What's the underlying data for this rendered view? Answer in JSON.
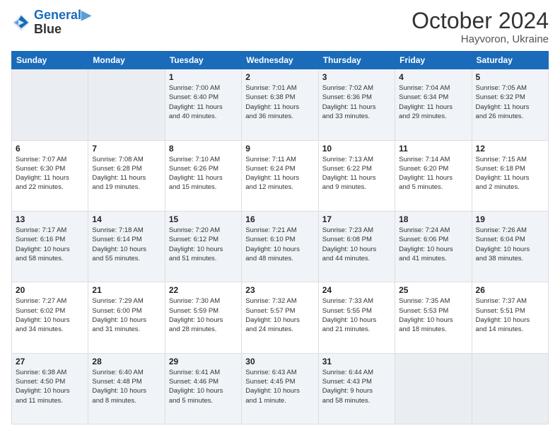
{
  "header": {
    "logo_line1": "General",
    "logo_line2": "Blue",
    "month": "October 2024",
    "location": "Hayvoron, Ukraine"
  },
  "weekdays": [
    "Sunday",
    "Monday",
    "Tuesday",
    "Wednesday",
    "Thursday",
    "Friday",
    "Saturday"
  ],
  "weeks": [
    [
      {
        "day": "",
        "text": ""
      },
      {
        "day": "",
        "text": ""
      },
      {
        "day": "1",
        "text": "Sunrise: 7:00 AM\nSunset: 6:40 PM\nDaylight: 11 hours\nand 40 minutes."
      },
      {
        "day": "2",
        "text": "Sunrise: 7:01 AM\nSunset: 6:38 PM\nDaylight: 11 hours\nand 36 minutes."
      },
      {
        "day": "3",
        "text": "Sunrise: 7:02 AM\nSunset: 6:36 PM\nDaylight: 11 hours\nand 33 minutes."
      },
      {
        "day": "4",
        "text": "Sunrise: 7:04 AM\nSunset: 6:34 PM\nDaylight: 11 hours\nand 29 minutes."
      },
      {
        "day": "5",
        "text": "Sunrise: 7:05 AM\nSunset: 6:32 PM\nDaylight: 11 hours\nand 26 minutes."
      }
    ],
    [
      {
        "day": "6",
        "text": "Sunrise: 7:07 AM\nSunset: 6:30 PM\nDaylight: 11 hours\nand 22 minutes."
      },
      {
        "day": "7",
        "text": "Sunrise: 7:08 AM\nSunset: 6:28 PM\nDaylight: 11 hours\nand 19 minutes."
      },
      {
        "day": "8",
        "text": "Sunrise: 7:10 AM\nSunset: 6:26 PM\nDaylight: 11 hours\nand 15 minutes."
      },
      {
        "day": "9",
        "text": "Sunrise: 7:11 AM\nSunset: 6:24 PM\nDaylight: 11 hours\nand 12 minutes."
      },
      {
        "day": "10",
        "text": "Sunrise: 7:13 AM\nSunset: 6:22 PM\nDaylight: 11 hours\nand 9 minutes."
      },
      {
        "day": "11",
        "text": "Sunrise: 7:14 AM\nSunset: 6:20 PM\nDaylight: 11 hours\nand 5 minutes."
      },
      {
        "day": "12",
        "text": "Sunrise: 7:15 AM\nSunset: 6:18 PM\nDaylight: 11 hours\nand 2 minutes."
      }
    ],
    [
      {
        "day": "13",
        "text": "Sunrise: 7:17 AM\nSunset: 6:16 PM\nDaylight: 10 hours\nand 58 minutes."
      },
      {
        "day": "14",
        "text": "Sunrise: 7:18 AM\nSunset: 6:14 PM\nDaylight: 10 hours\nand 55 minutes."
      },
      {
        "day": "15",
        "text": "Sunrise: 7:20 AM\nSunset: 6:12 PM\nDaylight: 10 hours\nand 51 minutes."
      },
      {
        "day": "16",
        "text": "Sunrise: 7:21 AM\nSunset: 6:10 PM\nDaylight: 10 hours\nand 48 minutes."
      },
      {
        "day": "17",
        "text": "Sunrise: 7:23 AM\nSunset: 6:08 PM\nDaylight: 10 hours\nand 44 minutes."
      },
      {
        "day": "18",
        "text": "Sunrise: 7:24 AM\nSunset: 6:06 PM\nDaylight: 10 hours\nand 41 minutes."
      },
      {
        "day": "19",
        "text": "Sunrise: 7:26 AM\nSunset: 6:04 PM\nDaylight: 10 hours\nand 38 minutes."
      }
    ],
    [
      {
        "day": "20",
        "text": "Sunrise: 7:27 AM\nSunset: 6:02 PM\nDaylight: 10 hours\nand 34 minutes."
      },
      {
        "day": "21",
        "text": "Sunrise: 7:29 AM\nSunset: 6:00 PM\nDaylight: 10 hours\nand 31 minutes."
      },
      {
        "day": "22",
        "text": "Sunrise: 7:30 AM\nSunset: 5:59 PM\nDaylight: 10 hours\nand 28 minutes."
      },
      {
        "day": "23",
        "text": "Sunrise: 7:32 AM\nSunset: 5:57 PM\nDaylight: 10 hours\nand 24 minutes."
      },
      {
        "day": "24",
        "text": "Sunrise: 7:33 AM\nSunset: 5:55 PM\nDaylight: 10 hours\nand 21 minutes."
      },
      {
        "day": "25",
        "text": "Sunrise: 7:35 AM\nSunset: 5:53 PM\nDaylight: 10 hours\nand 18 minutes."
      },
      {
        "day": "26",
        "text": "Sunrise: 7:37 AM\nSunset: 5:51 PM\nDaylight: 10 hours\nand 14 minutes."
      }
    ],
    [
      {
        "day": "27",
        "text": "Sunrise: 6:38 AM\nSunset: 4:50 PM\nDaylight: 10 hours\nand 11 minutes."
      },
      {
        "day": "28",
        "text": "Sunrise: 6:40 AM\nSunset: 4:48 PM\nDaylight: 10 hours\nand 8 minutes."
      },
      {
        "day": "29",
        "text": "Sunrise: 6:41 AM\nSunset: 4:46 PM\nDaylight: 10 hours\nand 5 minutes."
      },
      {
        "day": "30",
        "text": "Sunrise: 6:43 AM\nSunset: 4:45 PM\nDaylight: 10 hours\nand 1 minute."
      },
      {
        "day": "31",
        "text": "Sunrise: 6:44 AM\nSunset: 4:43 PM\nDaylight: 9 hours\nand 58 minutes."
      },
      {
        "day": "",
        "text": ""
      },
      {
        "day": "",
        "text": ""
      }
    ]
  ]
}
